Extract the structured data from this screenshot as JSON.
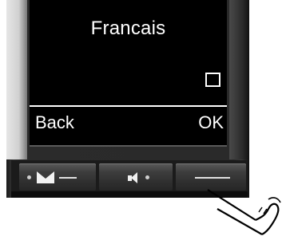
{
  "display": {
    "title": "Francais",
    "checkbox_checked": false
  },
  "softkeys": {
    "left": "Back",
    "right": "OK"
  },
  "keys": [
    {
      "name": "message-key",
      "icon": "envelope-icon"
    },
    {
      "name": "handsfree-key",
      "icon": "speaker-icon"
    },
    {
      "name": "end-call-key",
      "icon": "line-icon"
    }
  ]
}
